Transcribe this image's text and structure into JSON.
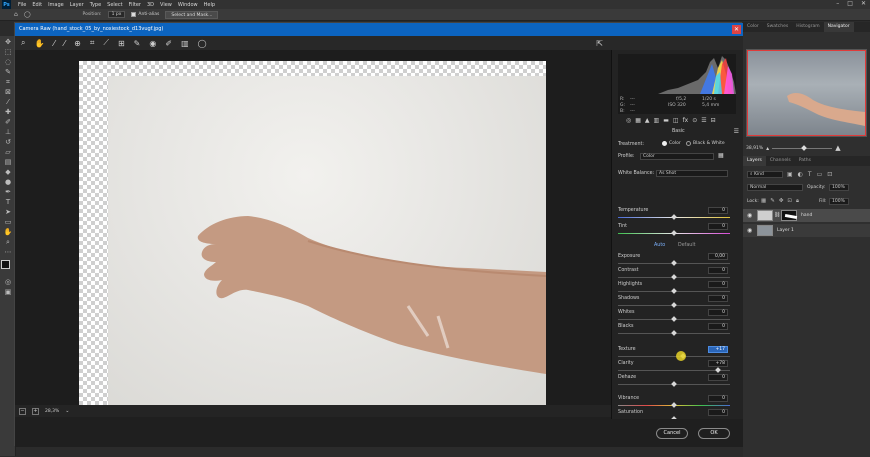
{
  "menubar": {
    "items": [
      "File",
      "Edit",
      "Image",
      "Layer",
      "Type",
      "Select",
      "Filter",
      "3D",
      "View",
      "Window",
      "Help"
    ],
    "logo": "Ps"
  },
  "optbar": {
    "position_label": "Position:",
    "position_value": "1 px",
    "antialias_label": "Anti-alias",
    "select_mask": "Select and Mask..."
  },
  "dialog": {
    "title": "Camera Raw (hand_stock_05_by_noxiestock_d13vugf.jpg)",
    "zoom": "28,3%",
    "cancel": "Cancel",
    "ok": "OK"
  },
  "histogram": {
    "r_label": "R:",
    "g_label": "G:",
    "b_label": "B:",
    "r_val": "---",
    "g_val": "---",
    "b_val": "---",
    "fstop": "f/5,2",
    "shutter": "1/20 s",
    "iso": "ISO 320",
    "focal": "5,4 mm"
  },
  "basic": {
    "panel_title": "Basic",
    "treatment_label": "Treatment:",
    "color_option": "Color",
    "bw_option": "Black & White",
    "profile_label": "Profile:",
    "profile_value": "Color",
    "wb_label": "White Balance:",
    "wb_value": "As Shot",
    "auto": "Auto",
    "default": "Default",
    "sliders": [
      {
        "label": "Temperature",
        "value": "0",
        "pos": 0.5
      },
      {
        "label": "Tint",
        "value": "0",
        "pos": 0.5
      },
      {
        "label": "Exposure",
        "value": "0,00",
        "pos": 0.5
      },
      {
        "label": "Contrast",
        "value": "0",
        "pos": 0.5
      },
      {
        "label": "Highlights",
        "value": "0",
        "pos": 0.5
      },
      {
        "label": "Shadows",
        "value": "0",
        "pos": 0.5
      },
      {
        "label": "Whites",
        "value": "0",
        "pos": 0.5
      },
      {
        "label": "Blacks",
        "value": "0",
        "pos": 0.5
      },
      {
        "label": "Texture",
        "value": "+17",
        "pos": 0.58
      },
      {
        "label": "Clarity",
        "value": "+78",
        "pos": 0.89
      },
      {
        "label": "Dehaze",
        "value": "0",
        "pos": 0.5
      },
      {
        "label": "Vibrance",
        "value": "0",
        "pos": 0.5
      },
      {
        "label": "Saturation",
        "value": "0",
        "pos": 0.5
      }
    ]
  },
  "rightpanel": {
    "tabs": [
      "Color",
      "Swatches",
      "Histogram",
      "Navigator"
    ],
    "nav_zoom": "38,91%",
    "layer_tabs": [
      "Layers",
      "Channels",
      "Paths"
    ],
    "kind": "Kind",
    "blend": "Normal",
    "opacity_label": "Opacity:",
    "opacity": "100%",
    "lock_label": "Lock:",
    "fill_label": "Fill:",
    "fill": "100%",
    "layers": [
      "hand",
      "Layer 1"
    ]
  },
  "colors": {
    "titlebar": "#0c64c0",
    "active_value": "#2a65b8"
  }
}
